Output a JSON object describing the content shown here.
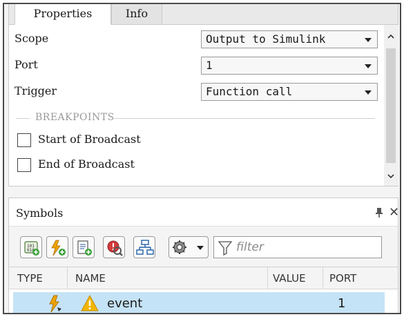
{
  "tabs": [
    {
      "label": "Properties",
      "active": true
    },
    {
      "label": "Info",
      "active": false
    }
  ],
  "properties": {
    "scope": {
      "label": "Scope",
      "value": "Output to Simulink"
    },
    "port": {
      "label": "Port",
      "value": "1"
    },
    "trigger": {
      "label": "Trigger",
      "value": "Function call"
    },
    "breakpoints_header": "BREAKPOINTS",
    "breakpoints": [
      {
        "label": "Start of Broadcast",
        "checked": false
      },
      {
        "label": "End of Broadcast",
        "checked": false
      }
    ]
  },
  "symbols": {
    "title": "Symbols",
    "filter_placeholder": "filter",
    "toolbar_icons": [
      "add-data-icon",
      "add-event-icon",
      "add-message-icon",
      "resolve-undefined-icon",
      "model-hierarchy-icon",
      "settings-icon"
    ],
    "columns": {
      "type": "TYPE",
      "name": "NAME",
      "value": "VALUE",
      "port": "PORT"
    },
    "rows": [
      {
        "type_icon": "event-type-icon",
        "status_icon": "warning-icon",
        "name": "event",
        "value": "",
        "port": "1",
        "selected": true
      }
    ]
  },
  "colors": {
    "selection": "#c5e3f6",
    "warning": "#f2b705",
    "event_bolt": "#f0a400"
  }
}
